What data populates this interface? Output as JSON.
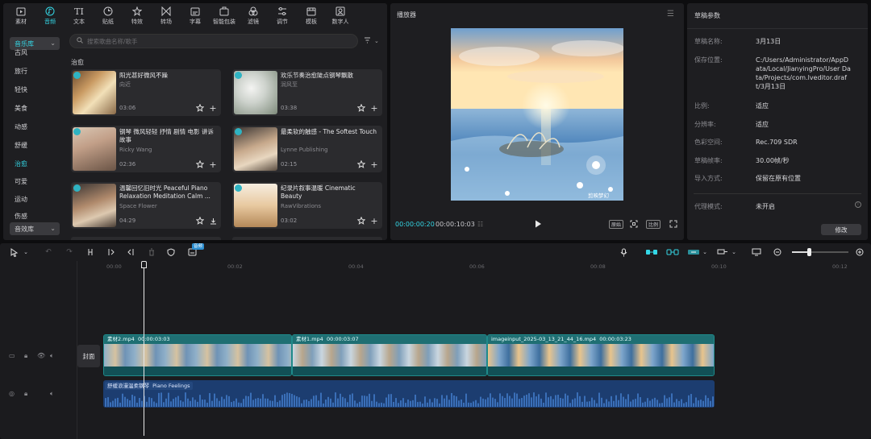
{
  "toolbar": [
    {
      "label": "素材",
      "icon": "media-icon",
      "active": false
    },
    {
      "label": "音频",
      "icon": "audio-icon",
      "active": true
    },
    {
      "label": "文本",
      "icon": "text-icon",
      "active": false
    },
    {
      "label": "贴纸",
      "icon": "sticker-icon",
      "active": false
    },
    {
      "label": "特效",
      "icon": "effect-icon",
      "active": false
    },
    {
      "label": "转场",
      "icon": "transition-icon",
      "active": false
    },
    {
      "label": "字幕",
      "icon": "subtitle-icon",
      "active": false
    },
    {
      "label": "智能包装",
      "icon": "smart-pack-icon",
      "active": false
    },
    {
      "label": "滤镜",
      "icon": "filter-icon",
      "active": false
    },
    {
      "label": "调节",
      "icon": "adjust-icon",
      "active": false
    },
    {
      "label": "模板",
      "icon": "template-icon",
      "active": false
    },
    {
      "label": "数字人",
      "icon": "avatar-icon",
      "active": false
    }
  ],
  "sidebar": {
    "selected": "音乐库",
    "items": [
      "古风",
      "旅行",
      "轻快",
      "美食",
      "动感",
      "舒缓",
      "治愈",
      "可爱",
      "运动",
      "伤感"
    ],
    "active_item": "治愈",
    "bottom_select": "音效库"
  },
  "search": {
    "placeholder": "搜索歌曲名称/歌手"
  },
  "section_title": "治愈",
  "cards": [
    {
      "title": "阳光甚好微风不躁",
      "artist": "向近",
      "duration": "03:06"
    },
    {
      "title": "欢乐节奏治愈陡点钢琴飘散",
      "artist": "润风至",
      "duration": "03:38"
    },
    {
      "title": "钢琴 微风轻轻 抒情 剧情 电影 讲诉故事",
      "artist": "Ricky Wang",
      "duration": "02:36"
    },
    {
      "title": "最柔软的触感 - The Softest Touch",
      "artist": "Lynne Publishing",
      "duration": "02:15"
    },
    {
      "title": "温馨回忆旧时光 Peaceful Piano Relaxation Meditation Calm ...",
      "artist": "Space Flower",
      "duration": "04:29"
    },
    {
      "title": "纪录片叙事温暖 Cinematic Beauty",
      "artist": "RawVibrations",
      "duration": "03:02"
    }
  ],
  "player": {
    "title": "播放器",
    "current_time": "00:00:00:20",
    "total_time": "00:00:10:03",
    "controls": [
      "原始",
      "比例"
    ],
    "watermark": "剪映梦幻"
  },
  "draft": {
    "title": "草稿参数",
    "fields": [
      {
        "label": "草稿名称:",
        "value": "3月13日"
      },
      {
        "label": "保存位置:",
        "value": "C:/Users/Administrator/AppData/Local/JianyingPro/User Data/Projects/com.lveditor.draft/3月13日"
      },
      {
        "label": "比例:",
        "value": "适应"
      },
      {
        "label": "分辨率:",
        "value": "适应"
      },
      {
        "label": "色彩空间:",
        "value": "Rec.709 SDR"
      },
      {
        "label": "草稿帧率:",
        "value": "30.00帧/秒"
      },
      {
        "label": "导入方式:",
        "value": "保留在原有位置"
      },
      {
        "label": "代理模式:",
        "value": "未开启"
      }
    ],
    "button": "修改"
  },
  "timeline": {
    "tag": "音频",
    "ruler": [
      "00:00",
      "00:02",
      "00:04",
      "00:06",
      "00:08",
      "00:10",
      "00:12"
    ],
    "cover_label": "封面",
    "clips": [
      {
        "name": "素材2.mp4",
        "duration": "00:00:03:03"
      },
      {
        "name": "素材1.mp4",
        "duration": "00:00:03:07"
      },
      {
        "name": "imageinput_2025-03_13_21_44_16.mp4",
        "duration": "00:00:03:23"
      }
    ],
    "audio": {
      "name": "舒缓浪漫温柔钢琴",
      "sub": "Piano Feelings"
    },
    "zoom": 0.3
  },
  "colors": {
    "accent": "#34d7e6",
    "video_clip": "#1f6f73",
    "audio_clip": "#1c3d70"
  }
}
